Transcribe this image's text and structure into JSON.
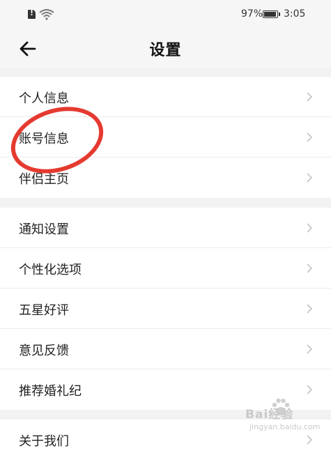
{
  "status_bar": {
    "battery_percent": "97%",
    "time": "3:05",
    "icons": [
      "sim-alert-icon",
      "wifi-icon",
      "battery-icon"
    ]
  },
  "header": {
    "title": "设置",
    "back_icon": "arrow-left-icon"
  },
  "groups": [
    {
      "items": [
        {
          "label": "个人信息"
        },
        {
          "label": "账号信息"
        },
        {
          "label": "伴侣主页"
        }
      ]
    },
    {
      "items": [
        {
          "label": "通知设置"
        },
        {
          "label": "个性化选项"
        },
        {
          "label": "五星好评"
        },
        {
          "label": "意见反馈"
        },
        {
          "label": "推荐婚礼纪"
        }
      ]
    },
    {
      "items": [
        {
          "label": "关于我们"
        }
      ]
    }
  ],
  "annotation": {
    "highlighted_item": "账号信息",
    "color": "#e53a30"
  },
  "watermark": {
    "logo": "Bai经验",
    "url": "jingyan.baidu.com"
  },
  "colors": {
    "background": "#f2f2f3",
    "surface": "#ffffff",
    "chevron": "#c4c4c4"
  }
}
